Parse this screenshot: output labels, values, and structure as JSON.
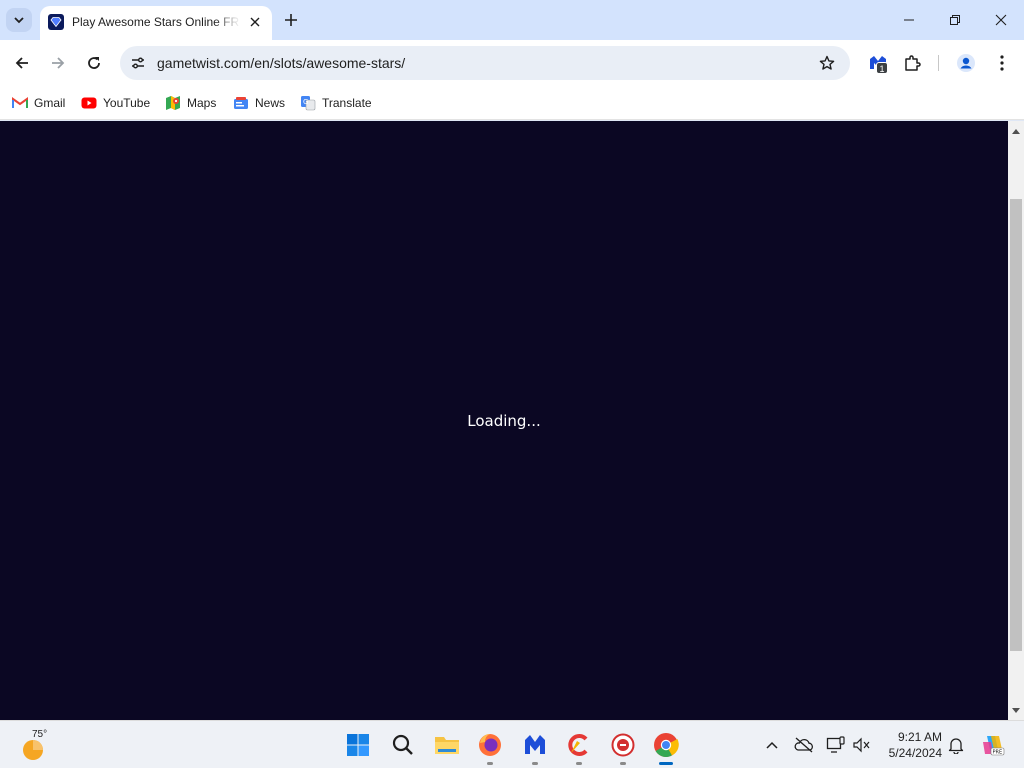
{
  "browser": {
    "tab": {
      "title": "Play Awesome Stars Online FREE",
      "favicon": "gametwist-diamond-icon"
    },
    "address_bar": {
      "url": "gametwist.com/en/slots/awesome-stars/"
    },
    "extensions_badge": "1",
    "bookmarks": [
      {
        "label": "Gmail",
        "icon": "gmail-icon"
      },
      {
        "label": "YouTube",
        "icon": "youtube-icon"
      },
      {
        "label": "Maps",
        "icon": "maps-icon"
      },
      {
        "label": "News",
        "icon": "news-icon"
      },
      {
        "label": "Translate",
        "icon": "translate-icon"
      }
    ],
    "colors": {
      "tabstrip": "#d3e3fd",
      "page_background": "#0b0723"
    }
  },
  "page": {
    "loading_text": "Loading..."
  },
  "taskbar": {
    "weather_temp": "75°",
    "apps": [
      "windows-start-icon",
      "search-icon",
      "file-explorer-icon",
      "firefox-icon",
      "malwarebytes-icon",
      "ccleaner-icon",
      "app-red-icon",
      "chrome-icon"
    ],
    "clock": {
      "time": "9:21 AM",
      "date": "5/24/2024"
    }
  }
}
